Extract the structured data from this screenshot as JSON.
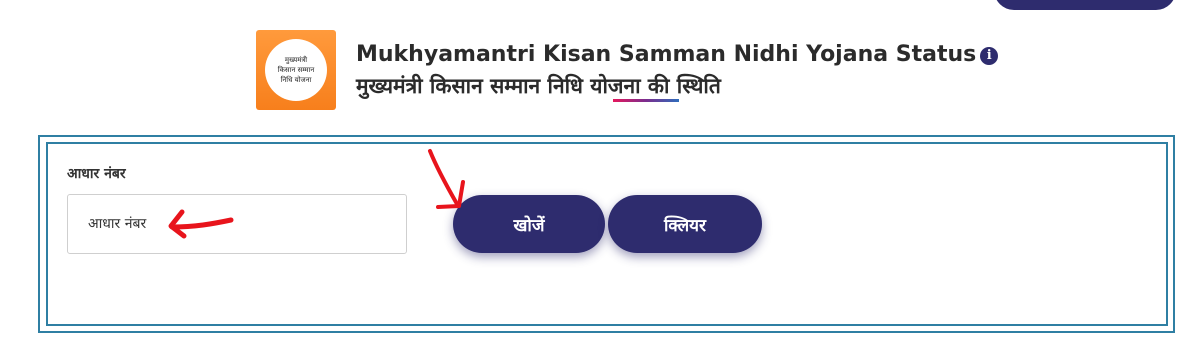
{
  "header": {
    "logo_text": "मुख्यमंत्री\nकिसान सम्मान\nनिधि योजना",
    "title_en": "Mukhyamantri Kisan Samman Nidhi Yojana Status",
    "info_icon_glyph": "i",
    "title_hi": "मुख्यमंत्री किसान सम्मान निधि योजना की स्थिति"
  },
  "form": {
    "aadhaar_label": "आधार नंबर",
    "aadhaar_placeholder": "आधार नंबर",
    "aadhaar_value": "",
    "search_label": "खोजें",
    "clear_label": "क्लियर"
  },
  "colors": {
    "brand": "#2e2c6e",
    "panel_border": "#2f7fa3",
    "logo_orange": "#f77f1c",
    "annotation_red": "#e8141c"
  },
  "icons": {
    "info": "info-circle-icon",
    "annotations": [
      "red-arrow-left-icon",
      "red-arrow-down-icon"
    ]
  }
}
